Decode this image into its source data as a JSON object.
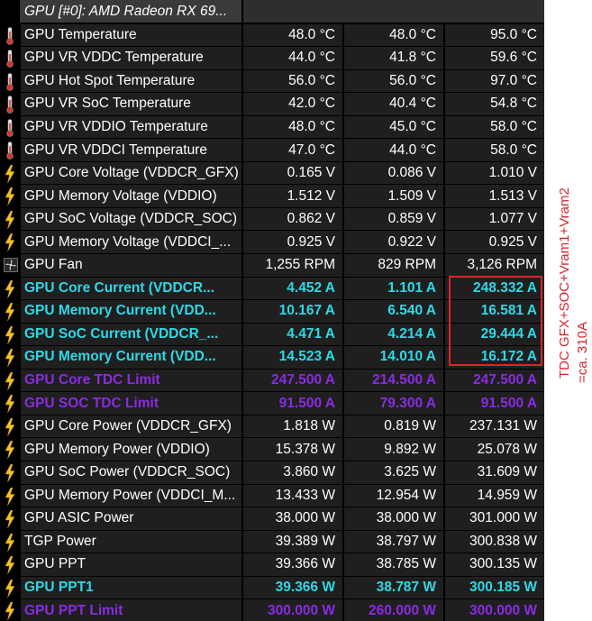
{
  "header": {
    "title": "GPU [#0]: AMD Radeon RX 69..."
  },
  "rows": [
    {
      "icon": "thermometer-icon",
      "label": "GPU Temperature",
      "current": "48.0 °C",
      "min": "48.0 °C",
      "max": "95.0 °C",
      "style": "normal"
    },
    {
      "icon": "thermometer-icon",
      "label": "GPU VR VDDC Temperature",
      "current": "44.0 °C",
      "min": "41.8 °C",
      "max": "59.6 °C",
      "style": "normal"
    },
    {
      "icon": "thermometer-icon",
      "label": "GPU Hot Spot Temperature",
      "current": "56.0 °C",
      "min": "56.0 °C",
      "max": "97.0 °C",
      "style": "normal"
    },
    {
      "icon": "thermometer-icon",
      "label": "GPU VR SoC Temperature",
      "current": "42.0 °C",
      "min": "40.4 °C",
      "max": "54.8 °C",
      "style": "normal"
    },
    {
      "icon": "thermometer-icon",
      "label": "GPU VR VDDIO Temperature",
      "current": "48.0 °C",
      "min": "45.0 °C",
      "max": "58.0 °C",
      "style": "normal"
    },
    {
      "icon": "thermometer-icon",
      "label": "GPU VR VDDCI Temperature",
      "current": "47.0 °C",
      "min": "44.0 °C",
      "max": "58.0 °C",
      "style": "normal"
    },
    {
      "icon": "lightning-bolt-icon",
      "label": "GPU Core Voltage (VDDCR_GFX)",
      "current": "0.165 V",
      "min": "0.086 V",
      "max": "1.010 V",
      "style": "normal"
    },
    {
      "icon": "lightning-bolt-icon",
      "label": "GPU Memory Voltage (VDDIO)",
      "current": "1.512 V",
      "min": "1.509 V",
      "max": "1.513 V",
      "style": "normal"
    },
    {
      "icon": "lightning-bolt-icon",
      "label": "GPU SoC Voltage (VDDCR_SOC)",
      "current": "0.862 V",
      "min": "0.859 V",
      "max": "1.077 V",
      "style": "normal"
    },
    {
      "icon": "lightning-bolt-icon",
      "label": "GPU Memory Voltage (VDDCI_...",
      "current": "0.925 V",
      "min": "0.922 V",
      "max": "0.925 V",
      "style": "normal"
    },
    {
      "icon": "fan-icon",
      "label": "GPU Fan",
      "current": "1,255 RPM",
      "min": "829 RPM",
      "max": "3,126 RPM",
      "style": "normal"
    },
    {
      "icon": "lightning-bolt-icon",
      "label": "GPU Core Current (VDDCR...",
      "current": "4.452 A",
      "min": "1.101 A",
      "max": "248.332 A",
      "style": "cyan"
    },
    {
      "icon": "lightning-bolt-icon",
      "label": "GPU Memory Current (VDD...",
      "current": "10.167 A",
      "min": "6.540 A",
      "max": "16.581 A",
      "style": "cyan"
    },
    {
      "icon": "lightning-bolt-icon",
      "label": "GPU SoC Current (VDDCR_...",
      "current": "4.471 A",
      "min": "4.214 A",
      "max": "29.444 A",
      "style": "cyan"
    },
    {
      "icon": "lightning-bolt-icon",
      "label": "GPU Memory Current (VDD...",
      "current": "14.523 A",
      "min": "14.010 A",
      "max": "16.172 A",
      "style": "cyan"
    },
    {
      "icon": "lightning-bolt-icon",
      "label": "GPU Core TDC Limit",
      "current": "247.500 A",
      "min": "214.500 A",
      "max": "247.500 A",
      "style": "purple"
    },
    {
      "icon": "lightning-bolt-icon",
      "label": "GPU SOC TDC Limit",
      "current": "91.500 A",
      "min": "79.300 A",
      "max": "91.500 A",
      "style": "purple"
    },
    {
      "icon": "lightning-bolt-icon",
      "label": "GPU Core Power (VDDCR_GFX)",
      "current": "1.818 W",
      "min": "0.819 W",
      "max": "237.131 W",
      "style": "normal"
    },
    {
      "icon": "lightning-bolt-icon",
      "label": "GPU Memory Power (VDDIO)",
      "current": "15.378 W",
      "min": "9.892 W",
      "max": "25.078 W",
      "style": "normal"
    },
    {
      "icon": "lightning-bolt-icon",
      "label": "GPU SoC Power (VDDCR_SOC)",
      "current": "3.860 W",
      "min": "3.625 W",
      "max": "31.609 W",
      "style": "normal"
    },
    {
      "icon": "lightning-bolt-icon",
      "label": "GPU Memory Power (VDDCI_M...",
      "current": "13.433 W",
      "min": "12.954 W",
      "max": "14.959 W",
      "style": "normal"
    },
    {
      "icon": "lightning-bolt-icon",
      "label": "GPU ASIC Power",
      "current": "38.000 W",
      "min": "38.000 W",
      "max": "301.000 W",
      "style": "normal"
    },
    {
      "icon": "lightning-bolt-icon",
      "label": "TGP Power",
      "current": "39.389 W",
      "min": "38.797 W",
      "max": "300.838 W",
      "style": "normal"
    },
    {
      "icon": "lightning-bolt-icon",
      "label": "GPU PPT",
      "current": "39.366 W",
      "min": "38.785 W",
      "max": "300.135 W",
      "style": "normal"
    },
    {
      "icon": "lightning-bolt-icon",
      "label": "GPU PPT1",
      "current": "39.366 W",
      "min": "38.787 W",
      "max": "300.185 W",
      "style": "cyan"
    },
    {
      "icon": "lightning-bolt-icon",
      "label": "GPU PPT Limit",
      "current": "300.000 W",
      "min": "260.000 W",
      "max": "300.000 W",
      "style": "purple"
    }
  ],
  "annotation": {
    "line1": "TDC GFX+SOC+Vram1+Vram2",
    "line2": "=ca. 310A"
  },
  "colors": {
    "cyan_text": "#2ed8e6",
    "purple_text": "#8a2be2",
    "annotation_red": "#d9252a",
    "row_bg": "#1f1f1f"
  }
}
